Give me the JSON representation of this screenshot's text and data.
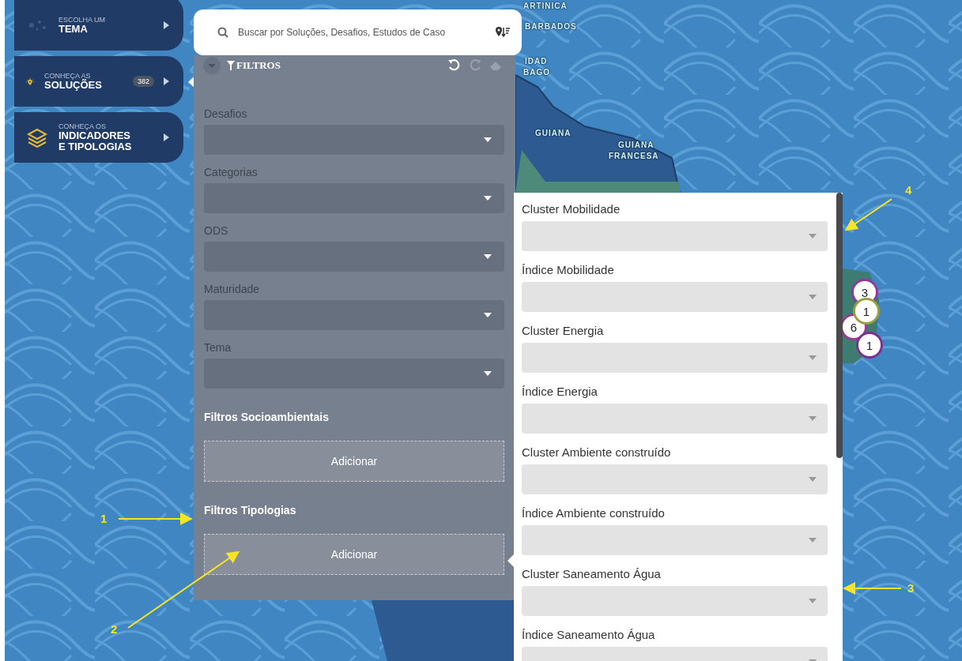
{
  "map": {
    "labels": [
      "ARTINICA",
      "BARBADOS",
      "IDAD",
      "BAGO",
      "GUIANA",
      "GUIANA",
      "FRANCESA"
    ],
    "markers": [
      {
        "count": "3",
        "color": "#8e3a9c"
      },
      {
        "count": "6",
        "color": "#9c3a8e"
      },
      {
        "count": "1",
        "color": "#9aa040"
      },
      {
        "count": "1",
        "color": "#7b2f8f"
      }
    ]
  },
  "nav": {
    "items": [
      {
        "overline": "ESCOLHA UM",
        "title": "TEMA",
        "selected": false
      },
      {
        "overline": "CONHEÇA AS",
        "title": "SOLUÇÕES",
        "badge": "382",
        "selected": true
      },
      {
        "overline": "CONHEÇA OS",
        "title": "INDICADORES E TIPOLOGIAS",
        "selected": false
      }
    ]
  },
  "search": {
    "placeholder": "Buscar por Soluções, Desafios, Estudos de Caso"
  },
  "filters": {
    "title": "FILTROS",
    "undo_disabled": false,
    "redo_disabled": true,
    "erase_disabled": true,
    "fields": [
      "Desafios",
      "Categorias",
      "ODS",
      "Maturidade",
      "Tema"
    ],
    "sections": [
      {
        "title": "Filtros Socioambientais",
        "button": "Adicionar"
      },
      {
        "title": "Filtros Tipologias",
        "button": "Adicionar"
      }
    ]
  },
  "typology_panel": {
    "fields": [
      "Cluster Mobilidade",
      "Índice Mobilidade",
      "Cluster Energia",
      "Índice Energia",
      "Cluster Ambiente construído",
      "Índice Ambiente construído",
      "Cluster Saneamento Água",
      "Índice Saneamento Água"
    ]
  },
  "annotations": [
    "1",
    "2",
    "3",
    "4"
  ]
}
